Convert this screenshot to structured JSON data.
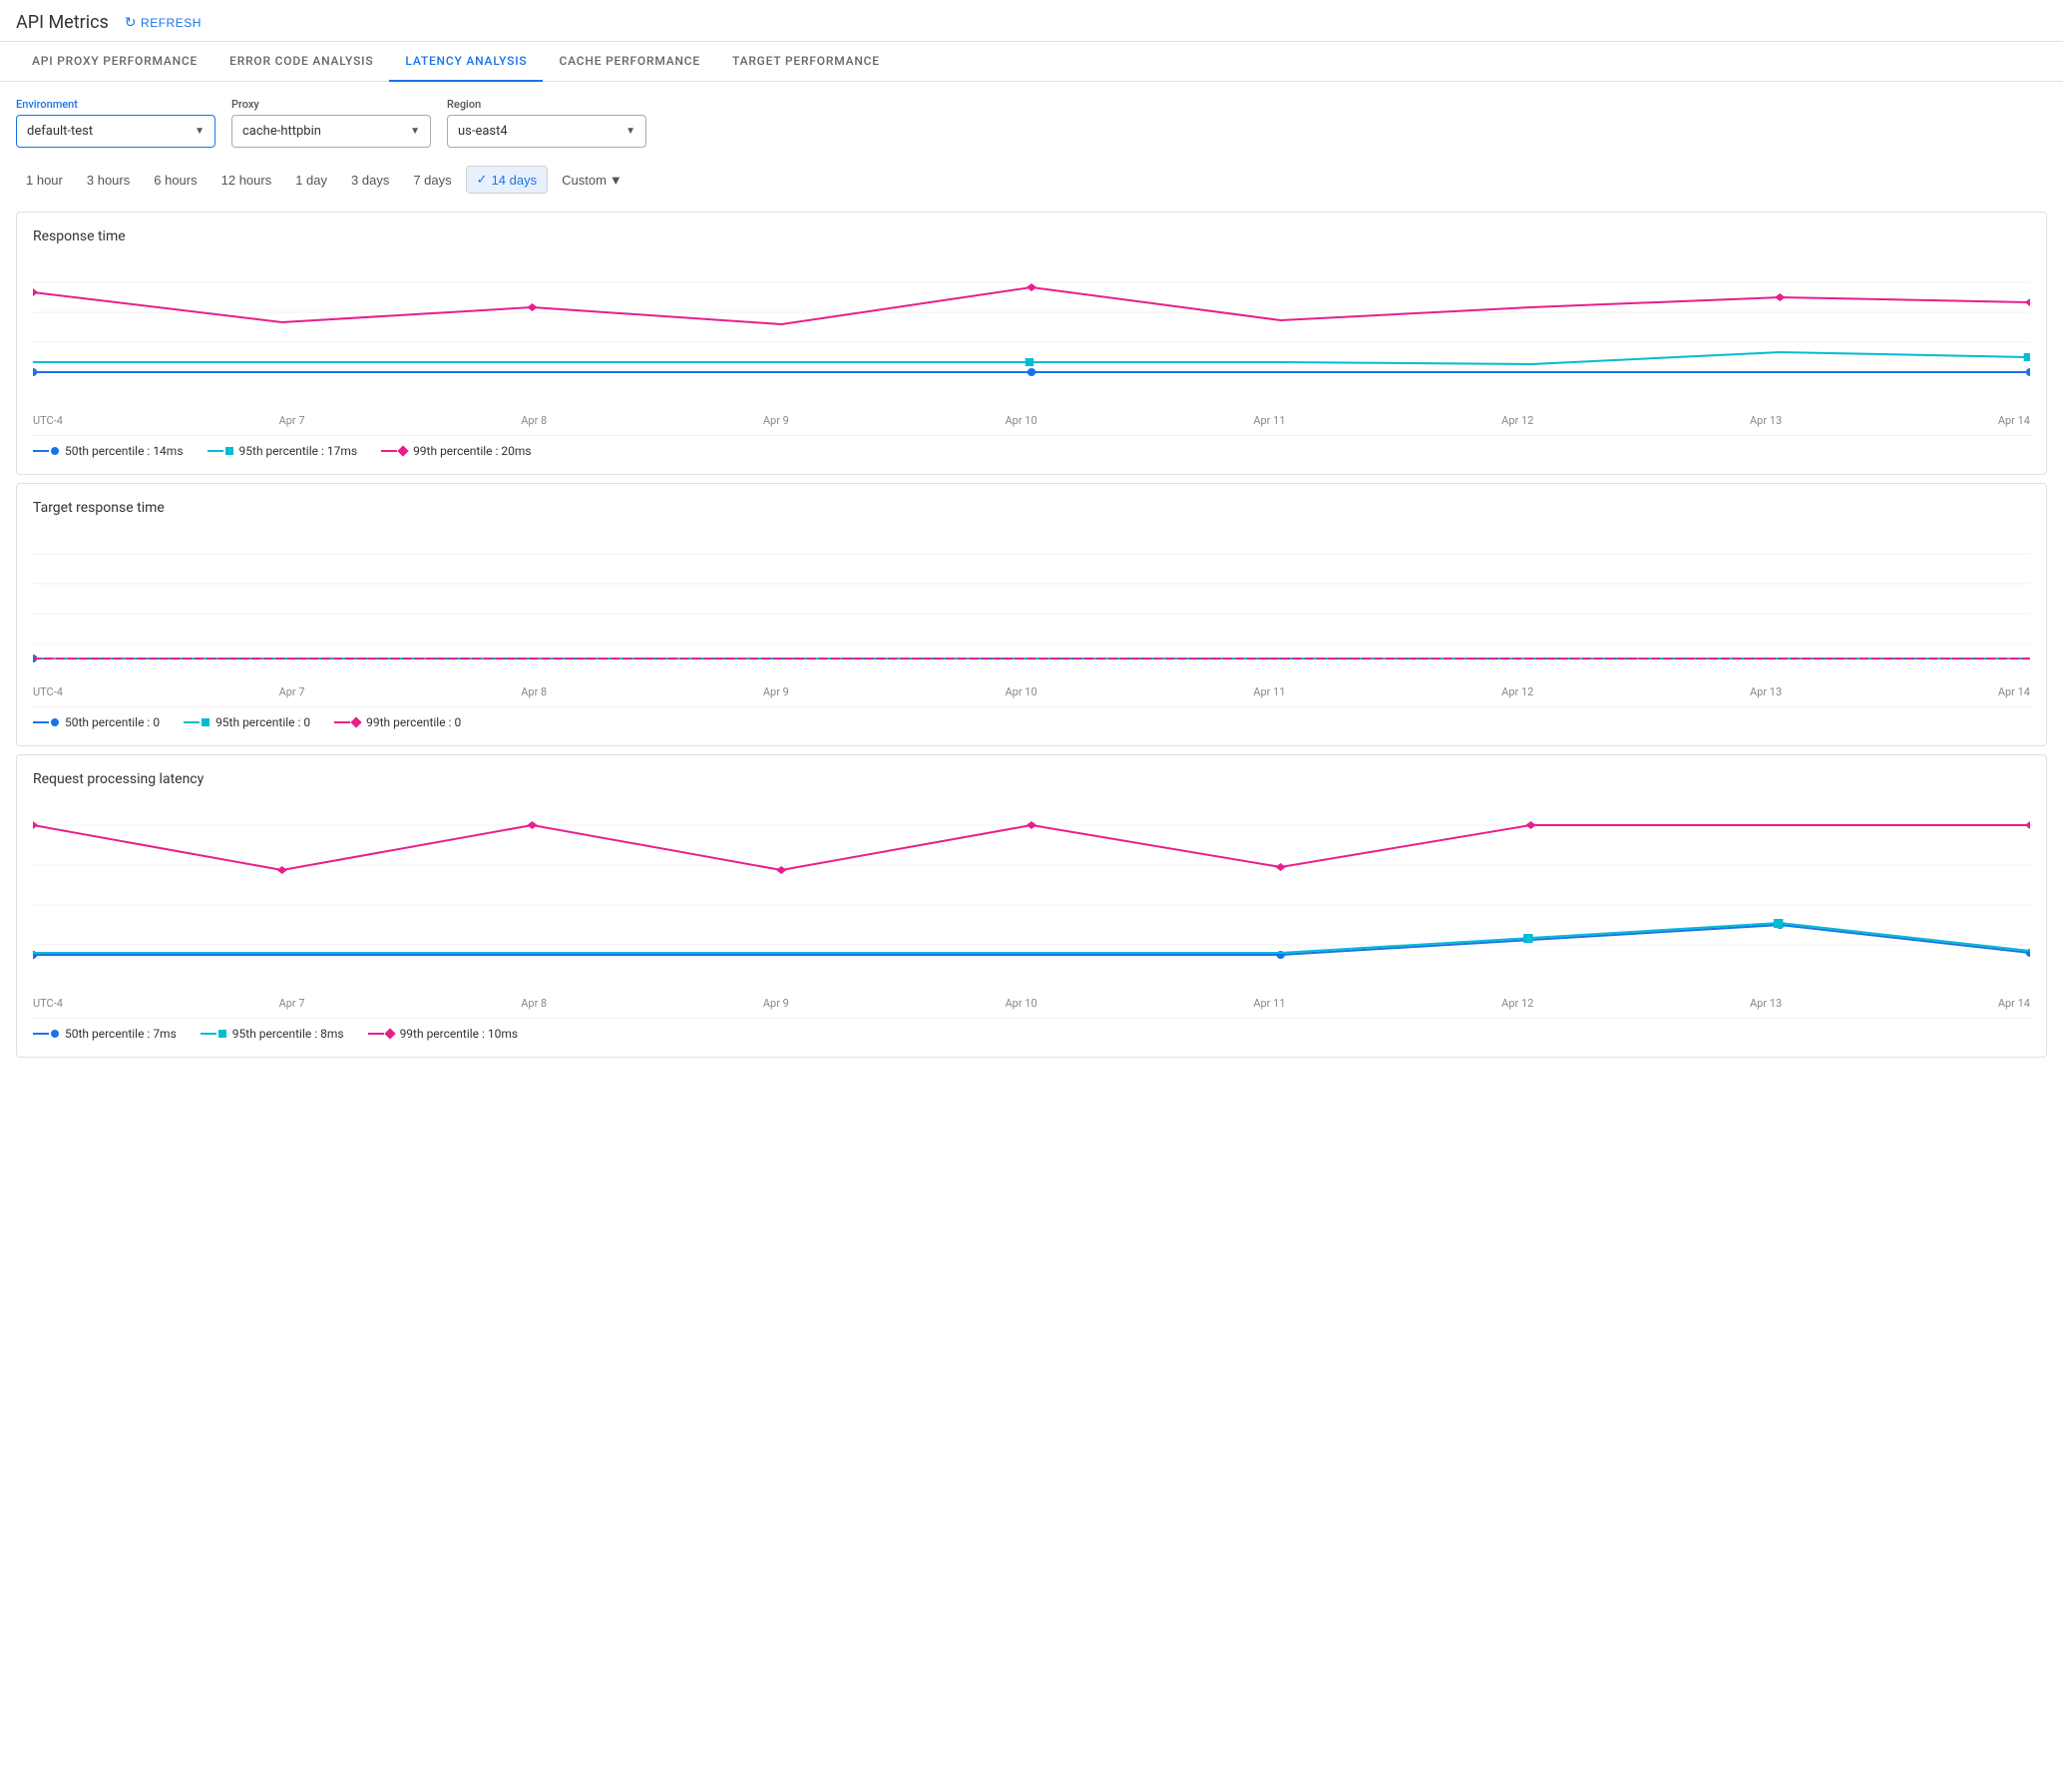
{
  "header": {
    "title": "API Metrics",
    "refresh_label": "REFRESH"
  },
  "tabs": [
    {
      "id": "api-proxy",
      "label": "API PROXY PERFORMANCE",
      "active": false
    },
    {
      "id": "error-code",
      "label": "ERROR CODE ANALYSIS",
      "active": false
    },
    {
      "id": "latency",
      "label": "LATENCY ANALYSIS",
      "active": true
    },
    {
      "id": "cache",
      "label": "CACHE PERFORMANCE",
      "active": false
    },
    {
      "id": "target",
      "label": "TARGET PERFORMANCE",
      "active": false
    }
  ],
  "filters": {
    "environment": {
      "label": "Environment",
      "value": "default-test"
    },
    "proxy": {
      "label": "Proxy",
      "value": "cache-httpbin"
    },
    "region": {
      "label": "Region",
      "value": "us-east4"
    }
  },
  "time_filters": [
    {
      "label": "1 hour",
      "active": false
    },
    {
      "label": "3 hours",
      "active": false
    },
    {
      "label": "6 hours",
      "active": false
    },
    {
      "label": "12 hours",
      "active": false
    },
    {
      "label": "1 day",
      "active": false
    },
    {
      "label": "3 days",
      "active": false
    },
    {
      "label": "7 days",
      "active": false
    },
    {
      "label": "14 days",
      "active": true
    },
    {
      "label": "Custom",
      "active": false,
      "has_arrow": true
    }
  ],
  "charts": {
    "response_time": {
      "title": "Response time",
      "x_labels": [
        "UTC-4",
        "Apr 7",
        "Apr 8",
        "Apr 9",
        "Apr 10",
        "Apr 11",
        "Apr 12",
        "Apr 13",
        "Apr 14"
      ],
      "legend": [
        {
          "type": "line-dot",
          "color": "blue",
          "label": "50th percentile : 14ms"
        },
        {
          "type": "line-square",
          "color": "teal",
          "label": "95th percentile : 17ms"
        },
        {
          "type": "line-diamond",
          "color": "pink",
          "label": "99th percentile : 20ms"
        }
      ]
    },
    "target_response_time": {
      "title": "Target response time",
      "x_labels": [
        "UTC-4",
        "Apr 7",
        "Apr 8",
        "Apr 9",
        "Apr 10",
        "Apr 11",
        "Apr 12",
        "Apr 13",
        "Apr 14"
      ],
      "legend": [
        {
          "type": "line-dot",
          "color": "blue",
          "label": "50th percentile : 0"
        },
        {
          "type": "line-square",
          "color": "teal",
          "label": "95th percentile : 0"
        },
        {
          "type": "line-diamond",
          "color": "pink",
          "label": "99th percentile : 0"
        }
      ]
    },
    "request_processing": {
      "title": "Request processing latency",
      "x_labels": [
        "UTC-4",
        "Apr 7",
        "Apr 8",
        "Apr 9",
        "Apr 10",
        "Apr 11",
        "Apr 12",
        "Apr 13",
        "Apr 14"
      ],
      "legend": [
        {
          "type": "line-dot",
          "color": "blue",
          "label": "50th percentile : 7ms"
        },
        {
          "type": "line-square",
          "color": "teal",
          "label": "95th percentile : 8ms"
        },
        {
          "type": "line-diamond",
          "color": "pink",
          "label": "99th percentile : 10ms"
        }
      ]
    }
  }
}
